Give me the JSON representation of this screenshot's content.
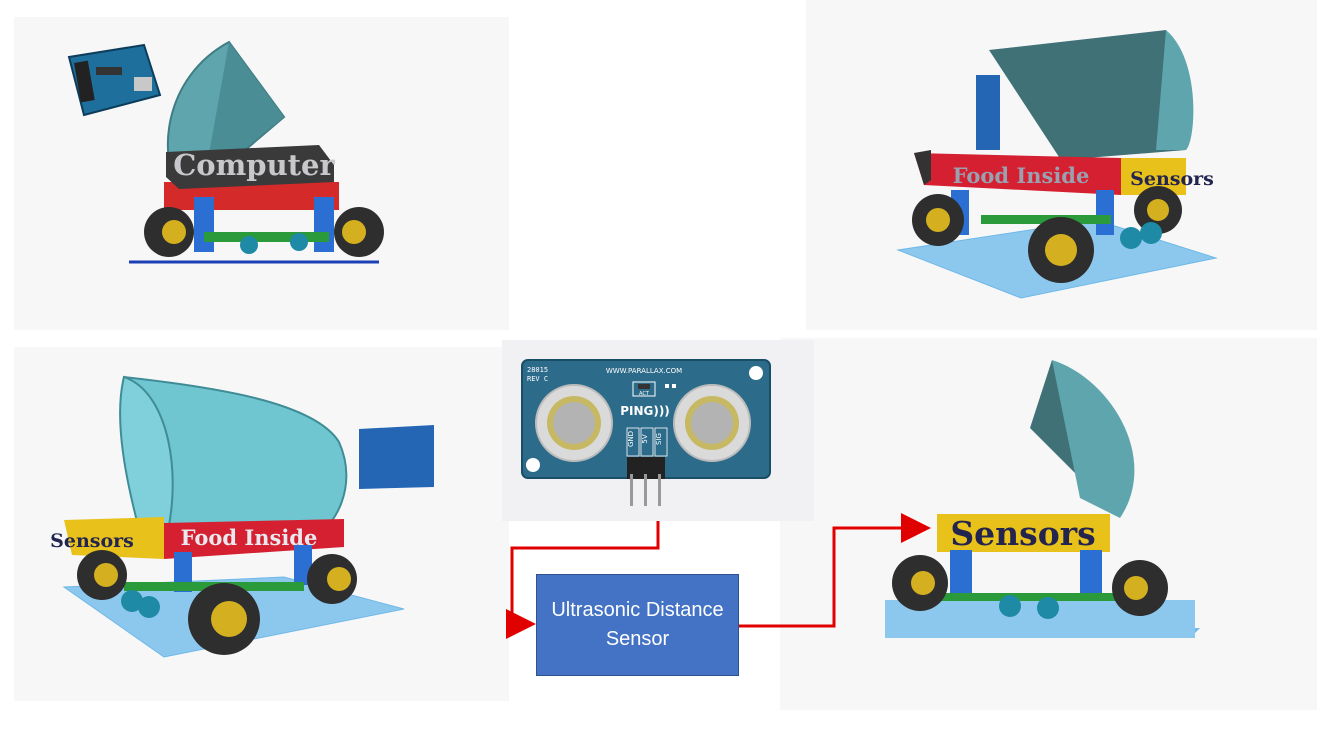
{
  "panels": {
    "computer_view": {
      "label": "Computer"
    },
    "rear_view": {
      "label_red": "Food Inside",
      "label_yellow": "Sensors"
    },
    "side_view": {
      "label_red": "Food Inside",
      "label_yellow": "Sensors"
    },
    "front_view": {
      "label": "Sensors"
    }
  },
  "sensor_board": {
    "model": "28015",
    "revision": "REV C",
    "website": "WWW.PARALLAX.COM",
    "act_label": "ACT",
    "brand": "PING)))",
    "pins": [
      "GND",
      "5V",
      "SIG"
    ]
  },
  "flow_box": {
    "label": "Ultrasonic Distance Sensor"
  },
  "colors": {
    "arrow": "#e00000",
    "box_fill": "#4472c4",
    "board_blue": "#2d6b8a",
    "shell": "#5fa5ad",
    "label_red": "#e3202c",
    "label_yellow": "#e8c21a",
    "grid_blue": "#6fb8e8"
  }
}
